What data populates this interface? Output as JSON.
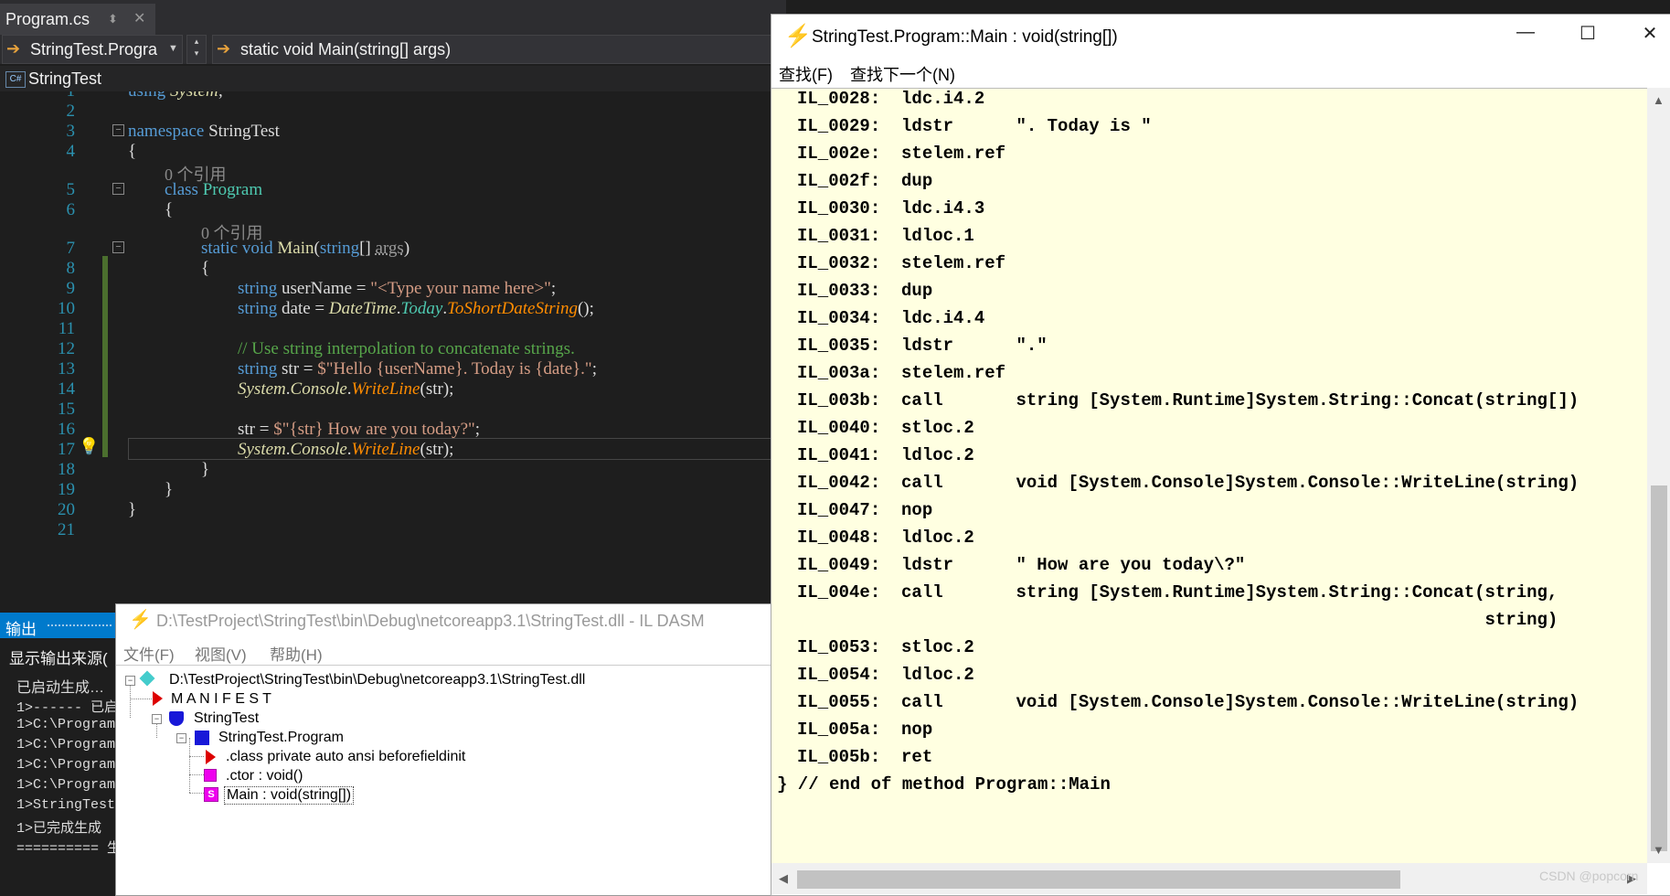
{
  "vs": {
    "tab_name": "Program.cs",
    "tab_pin": "⬍",
    "tab_close": "✕",
    "nav_class": "StringTest.Progra",
    "nav_method": "static void Main(string[] args)",
    "project": "StringTest",
    "line_numbers": [
      "1",
      "2",
      "3",
      "4",
      "5",
      "6",
      "7",
      "8",
      "9",
      "10",
      "11",
      "12",
      "13",
      "14",
      "15",
      "16",
      "17",
      "18",
      "19",
      "20",
      "21"
    ],
    "code": {
      "l1_using": "using ",
      "l1_ns": "System",
      "l1_semi": ";",
      "l3_kw": "namespace",
      "l3_name": " StringTest",
      "brace_open": "{",
      "brace_close": "}",
      "ref_count": "0 个引用",
      "l5_kw": "class",
      "l5_name": "Program",
      "l7_kw1": "static",
      "l7_kw2": "void",
      "l7_name": "Main",
      "l7_kw3": "string",
      "l7_rest": "[] ",
      "l7_arg": "args",
      "l7_end": ")",
      "paren_open": "(",
      "kw_string": "string",
      "l9_var": " userName = ",
      "l9_str": "\"<Type your name here>\"",
      "semi": ";",
      "l10_var": " date = ",
      "l10_dt": "DateTime",
      "dot": ".",
      "l10_today": "Today",
      "l10_method": "ToShortDateString",
      "l10_end": "();",
      "l12_comment": "// Use string interpolation to concatenate strings.",
      "l13_var": " str = ",
      "l13_s1": "$\"Hello ",
      "l13_v1": "{userName}",
      "l13_s2": ". Today is ",
      "l13_v2": "{date}",
      "l13_s3": ".\"",
      "l14_sys": "System",
      "l14_con": "Console",
      "l14_wl": "WriteLine",
      "l14_arg": "(str);",
      "l16_a": "str = ",
      "l16_s1": "$\"",
      "l16_v1": "{str}",
      "l16_s2": " How are you today?\"",
      "bulb": "💡"
    },
    "output": {
      "title": "输出",
      "source": "显示输出来源(",
      "lines": [
        "已启动生成…",
        "1>------ 已启",
        "1>C:\\Program",
        "1>C:\\Program",
        "1>C:\\Program",
        "1>C:\\Program",
        "1>StringTest",
        "1>已完成生成",
        "========== 生"
      ]
    }
  },
  "ildasm": {
    "title": "D:\\TestProject\\StringTest\\bin\\Debug\\netcoreapp3.1\\StringTest.dll - IL DASM",
    "menu": [
      "文件(F)",
      "视图(V)",
      "帮助(H)"
    ],
    "tree": {
      "root": "D:\\TestProject\\StringTest\\bin\\Debug\\netcoreapp3.1\\StringTest.dll",
      "manifest": "M A N I F E S T",
      "namespace": "StringTest",
      "class": "StringTest.Program",
      "class_decl": ".class private auto ansi beforefieldinit",
      "ctor": ".ctor : void()",
      "main": "Main : void(string[])",
      "toggle_minus": "−"
    }
  },
  "method": {
    "title": "StringTest.Program::Main : void(string[])",
    "icon": "⚡",
    "btn_min": "—",
    "btn_max": "☐",
    "btn_close": "✕",
    "menu": [
      "查找(F)",
      "查找下一个(N)"
    ],
    "il_lines": [
      "IL_0028:  ldc.i4.2",
      "IL_0029:  ldstr      \". Today is \"",
      "IL_002e:  stelem.ref",
      "IL_002f:  dup",
      "IL_0030:  ldc.i4.3",
      "IL_0031:  ldloc.1",
      "IL_0032:  stelem.ref",
      "IL_0033:  dup",
      "IL_0034:  ldc.i4.4",
      "IL_0035:  ldstr      \".\"",
      "IL_003a:  stelem.ref",
      "IL_003b:  call       string [System.Runtime]System.String::Concat(string[])",
      "IL_0040:  stloc.2",
      "IL_0041:  ldloc.2",
      "IL_0042:  call       void [System.Console]System.Console::WriteLine(string)",
      "IL_0047:  nop",
      "IL_0048:  ldloc.2",
      "IL_0049:  ldstr      \" How are you today\\?\"",
      "IL_004e:  call       string [System.Runtime]System.String::Concat(string,",
      "                                                                  string)",
      "IL_0053:  stloc.2",
      "IL_0054:  ldloc.2",
      "IL_0055:  call       void [System.Console]System.Console::WriteLine(string)",
      "IL_005a:  nop",
      "IL_005b:  ret"
    ],
    "end_line": "} // end of method Program::Main",
    "scroll_up": "▲",
    "scroll_down": "▼",
    "scroll_left": "◀",
    "scroll_right": "▶"
  },
  "watermark": "CSDN @popcorn"
}
